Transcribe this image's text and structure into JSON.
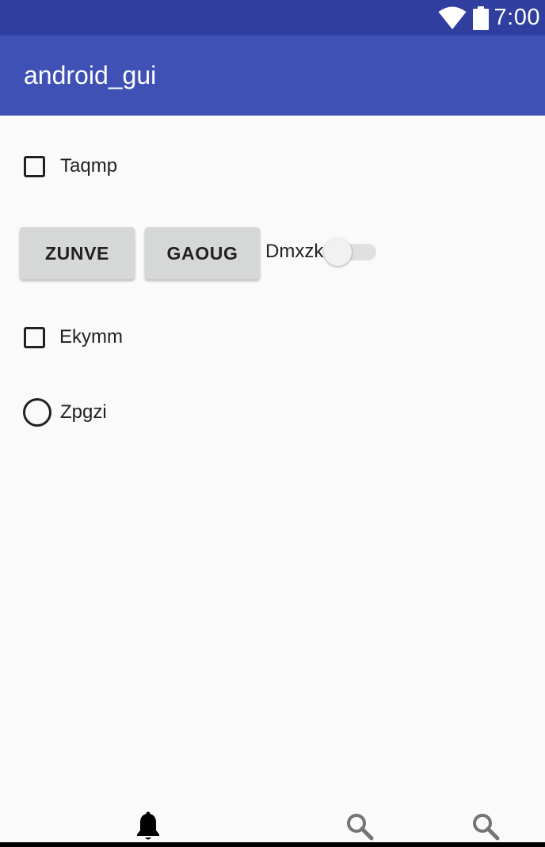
{
  "status_bar": {
    "time": "7:00",
    "icons": [
      "wifi-icon",
      "battery-icon"
    ]
  },
  "app_bar": {
    "title": "android_gui"
  },
  "controls": {
    "checkbox_1": {
      "label": "Taqmp",
      "checked": false
    },
    "button_1": {
      "label": "ZUNVE"
    },
    "button_2": {
      "label": "GAOUG"
    },
    "switch_1": {
      "label": "Dmxzk",
      "on": false
    },
    "checkbox_2": {
      "label": "Ekymm",
      "checked": false
    },
    "radio_1": {
      "label": "Zpgzi",
      "selected": false
    }
  },
  "bottom_nav": {
    "items": [
      {
        "icon": "bell-icon",
        "active": true
      },
      {
        "icon": "search-icon",
        "active": false
      },
      {
        "icon": "search-icon",
        "active": false
      }
    ]
  },
  "colors": {
    "status_bar": "#303f9f",
    "app_bar": "#3f51b5",
    "background": "#fafafa",
    "button": "#d6d7d7"
  }
}
